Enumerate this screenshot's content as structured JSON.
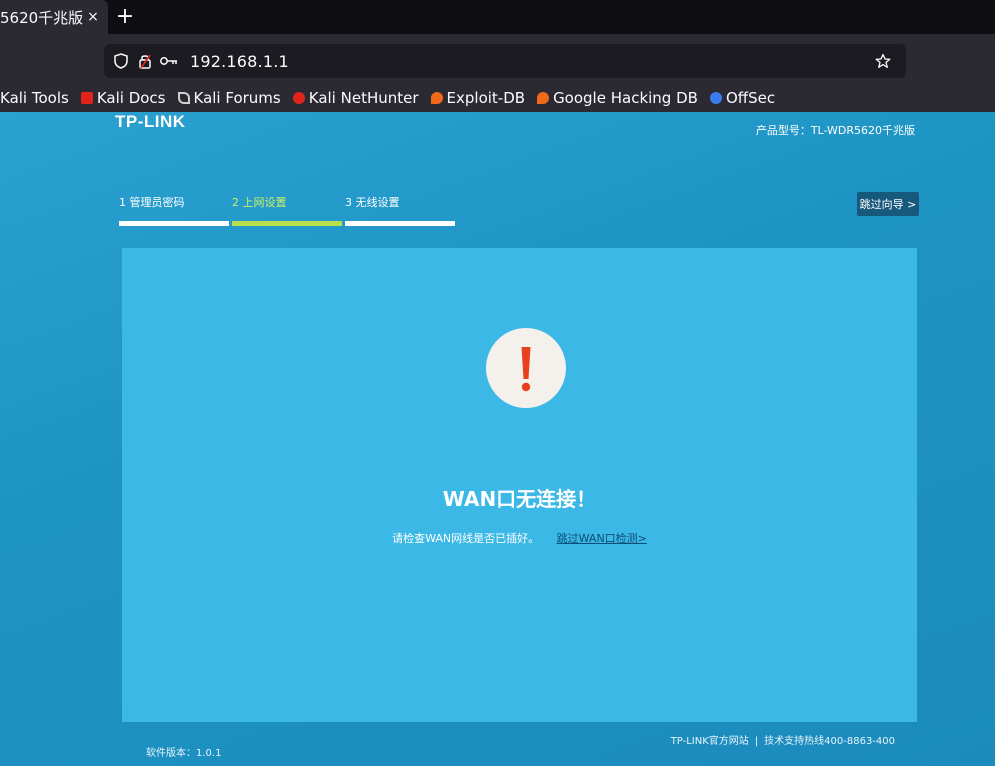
{
  "browser": {
    "tab": {
      "title": "5620千兆版",
      "close_glyph": "×"
    },
    "new_tab_glyph": "+",
    "url": "192.168.1.1",
    "bookmarks": [
      {
        "label": "Kali Tools",
        "icon": "kali-tools-icon",
        "color": ""
      },
      {
        "label": "Kali Docs",
        "icon": "kali-docs-icon",
        "color": "#e2231a"
      },
      {
        "label": "Kali Forums",
        "icon": "kali-forums-icon",
        "color": "#cfcfcf"
      },
      {
        "label": "Kali NetHunter",
        "icon": "kali-nethunter-icon",
        "color": "#e2231a"
      },
      {
        "label": "Exploit-DB",
        "icon": "exploit-db-icon",
        "color": "#f06a1a"
      },
      {
        "label": "Google Hacking DB",
        "icon": "google-hacking-db-icon",
        "color": "#f06a1a"
      },
      {
        "label": "OffSec",
        "icon": "offsec-icon",
        "color": "#3a7bf0"
      }
    ]
  },
  "router": {
    "brand": "TP-LINK",
    "model": "产品型号：TL-WDR5620千兆版",
    "steps": [
      {
        "label": "1 管理员密码",
        "active": false
      },
      {
        "label": "2 上网设置",
        "active": true
      },
      {
        "label": "3 无线设置",
        "active": false
      }
    ],
    "skip_wizard": "跳过向导 >",
    "alert": {
      "icon": "exclamation-icon",
      "title": "WAN口无连接！",
      "message": "请检查WAN网线是否已插好。",
      "link": "跳过WAN口检测>"
    },
    "version": "软件版本：1.0.1",
    "footer": {
      "website": "TP-LINK官方网站",
      "separator": "|",
      "hotline": "技术支持热线400-8863-400"
    },
    "colors": {
      "accent": "#b8e04d",
      "alert_mark": "#e8401c",
      "panel": "#3bb8e6"
    }
  }
}
